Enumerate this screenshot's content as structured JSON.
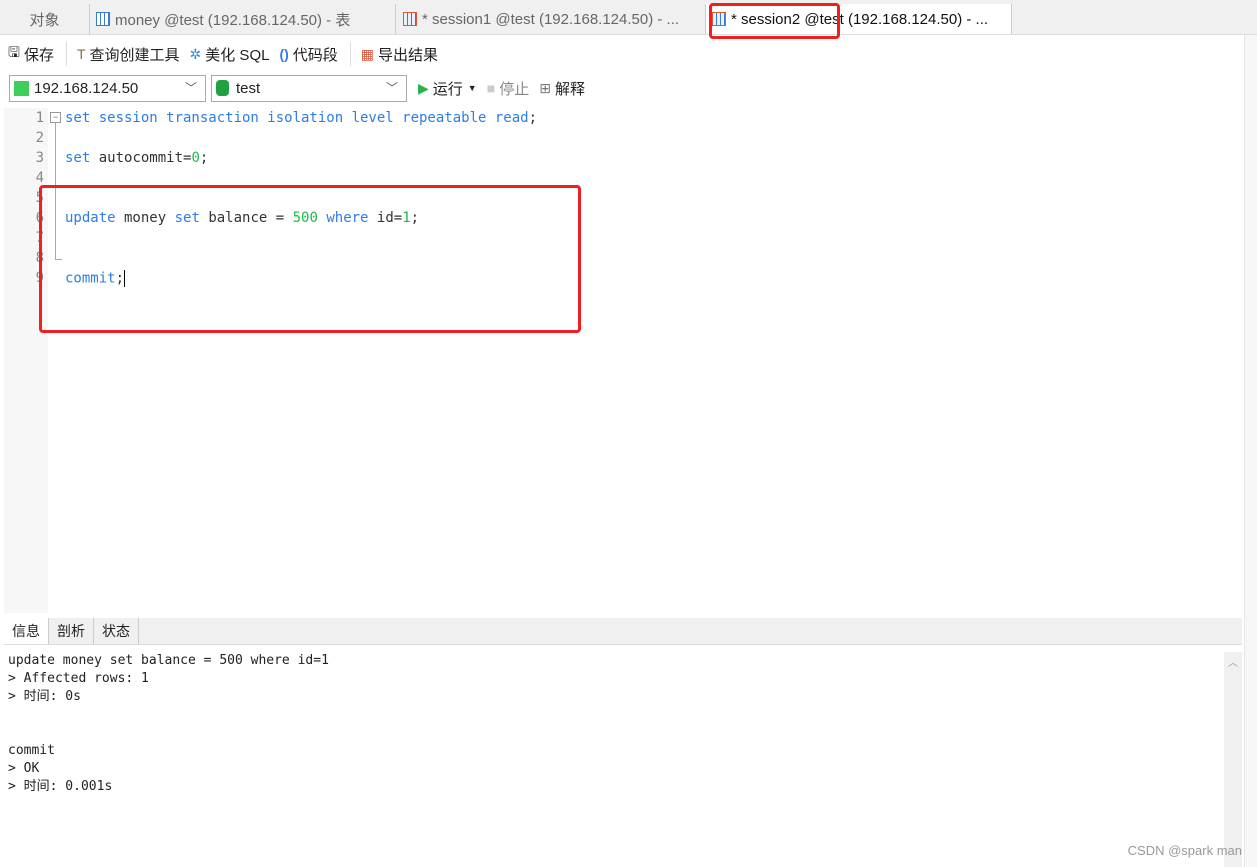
{
  "tabs": [
    {
      "label": "对象",
      "icon": "none"
    },
    {
      "label": "money @test (192.168.124.50) - 表",
      "icon": "table-icon"
    },
    {
      "label": "* session1 @test (192.168.124.50) - ...",
      "icon": "query-icon"
    },
    {
      "label": "* session2 @test (192.168.124.50) - ...",
      "icon": "query-icon",
      "active": true
    }
  ],
  "toolbar": {
    "save": "保存",
    "query_builder": "查询创建工具",
    "beautify": "美化 SQL",
    "snippet": "代码段",
    "export": "导出结果"
  },
  "connection": {
    "host": "192.168.124.50",
    "database": "test",
    "run": "运行",
    "stop": "停止",
    "explain": "解释"
  },
  "editor": {
    "line_numbers": [
      "1",
      "2",
      "3",
      "4",
      "5",
      "6",
      "7",
      "8",
      "9"
    ]
  },
  "bottom_tabs": [
    "信息",
    "剖析",
    "状态"
  ],
  "messages": "update money set balance = 500 where id=1\n> Affected rows: 1\n> 时间: 0s\n\n\ncommit\n> OK\n> 时间: 0.001s",
  "watermark": "CSDN @spark man",
  "colors": {
    "keyword": "#2b7de9",
    "number": "#1bbb4a",
    "highlight": "#f02020"
  }
}
